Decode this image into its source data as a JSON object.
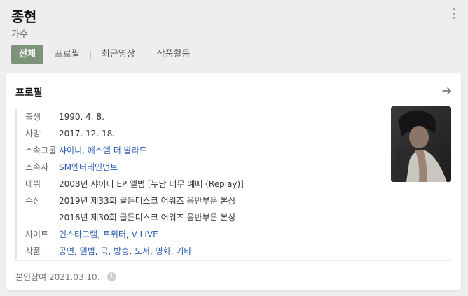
{
  "header": {
    "name": "종현",
    "subtitle": "가수",
    "tabs": [
      {
        "label": "전체"
      },
      {
        "label": "프로필"
      },
      {
        "label": "최근영상"
      },
      {
        "label": "작품활동"
      }
    ]
  },
  "profile": {
    "title": "프로필",
    "birth": {
      "label": "출생",
      "value": "1990. 4. 8."
    },
    "death": {
      "label": "사망",
      "value": "2017. 12. 18."
    },
    "group": {
      "label": "소속그룹",
      "links": [
        "샤이니",
        "에스엠 더 발라드"
      ]
    },
    "agency": {
      "label": "소속사",
      "value": "SM엔터테인먼트"
    },
    "debut": {
      "label": "데뷔",
      "value": "2008년 샤이니 EP 앨범 [누난 너무 예뻐 (Replay)]"
    },
    "awards": {
      "label": "수상",
      "lines": [
        "2019년 제33회 골든디스크 어워즈 음반부문 본상",
        "2016년 제30회 골든디스크 어워즈 음반부문 본상"
      ]
    },
    "sites": {
      "label": "사이트",
      "links": [
        "인스타그램",
        "트위터",
        "V LIVE"
      ]
    },
    "works": {
      "label": "작품",
      "links": [
        "공연",
        "앨범",
        "곡",
        "방송",
        "도서",
        "영화",
        "기타"
      ]
    },
    "footer": {
      "text": "본인참여 2021.03.10."
    }
  }
}
